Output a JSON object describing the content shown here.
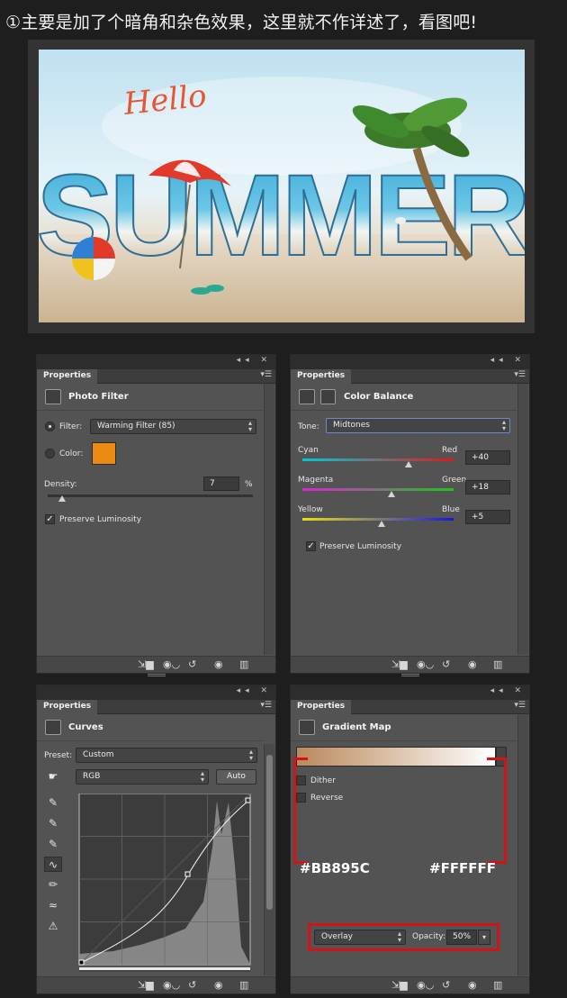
{
  "heading": "①主要是加了个暗角和杂色效果，这里就不作详述了，看图吧!",
  "preview": {
    "title_script": "Hello",
    "title_main": "SUMMER"
  },
  "panels": {
    "photo_filter": {
      "tab": "Properties",
      "title": "Photo Filter",
      "filter_label": "Filter:",
      "filter_value": "Warming Filter (85)",
      "color_label": "Color:",
      "color_swatch": "#ec8a14",
      "density_label": "Density:",
      "density_value": "7",
      "density_unit": "%",
      "density_level_pct": 7,
      "preserve_label": "Preserve Luminosity",
      "preserve_checked": true
    },
    "color_balance": {
      "tab": "Properties",
      "title": "Color Balance",
      "tone_label": "Tone:",
      "tone_value": "Midtones",
      "rows": [
        {
          "left": "Cyan",
          "right": "Red",
          "value": "+40",
          "level": 40,
          "gradient_from": "#00c8d8",
          "gradient_to": "#e01818"
        },
        {
          "left": "Magenta",
          "right": "Green",
          "value": "+18",
          "level": 18,
          "gradient_from": "#e020d8",
          "gradient_to": "#18c818"
        },
        {
          "left": "Yellow",
          "right": "Blue",
          "value": "+5",
          "level": 5,
          "gradient_from": "#e8e010",
          "gradient_to": "#1818e0"
        }
      ],
      "preserve_label": "Preserve Luminosity",
      "preserve_checked": true
    },
    "curves": {
      "tab": "Properties",
      "title": "Curves",
      "preset_label": "Preset:",
      "preset_value": "Custom",
      "channel_value": "RGB",
      "auto_label": "Auto"
    },
    "gradient_map": {
      "tab": "Properties",
      "title": "Gradient Map",
      "gradient_from": "#BB895C",
      "gradient_to": "#FFFFFF",
      "dither_label": "Dither",
      "reverse_label": "Reverse",
      "annot_left": "#BB895C",
      "annot_right": "#FFFFFF",
      "blend_mode": "Overlay",
      "opacity_label": "Opacity:",
      "opacity_value": "50%"
    }
  }
}
